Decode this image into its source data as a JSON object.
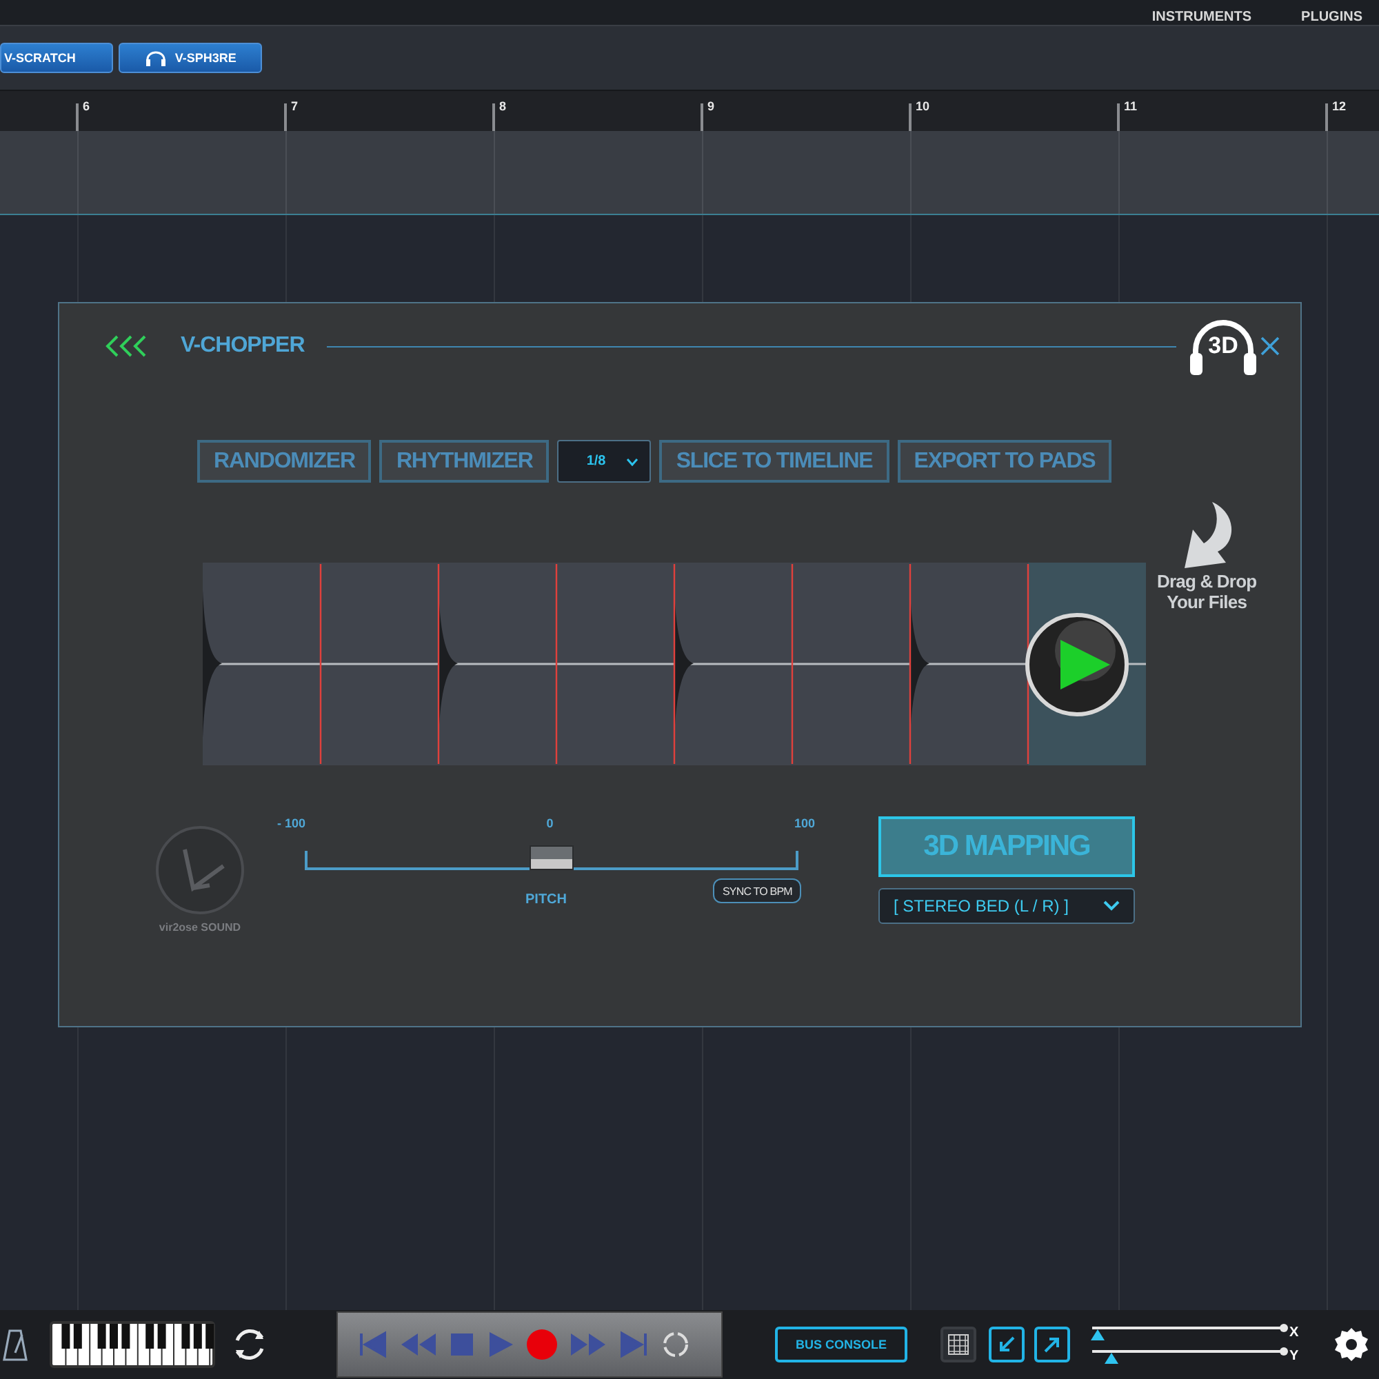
{
  "top_menu": [
    "INSTRUMENTS",
    "PLUGINS"
  ],
  "plugin_tabs": [
    {
      "kind": "plain",
      "label": "V-SCRATCH"
    },
    {
      "kind": "headphones",
      "label": "V-SPH3RE"
    }
  ],
  "ruler": {
    "marks": [
      "6",
      "7",
      "8",
      "9",
      "10",
      "11",
      "12"
    ]
  },
  "chopper": {
    "title": "V-CHOPPER",
    "badge": "3D",
    "toolbar": [
      {
        "kind": "button",
        "label": "RANDOMIZER"
      },
      {
        "kind": "button",
        "label": "RHYTHMIZER"
      },
      {
        "kind": "dropdown",
        "value": "1/8"
      },
      {
        "kind": "button",
        "label": "SLICE TO TIMELINE"
      },
      {
        "kind": "button",
        "label": "EXPORT TO PADS"
      }
    ],
    "slices": [
      {
        "selected": false
      },
      {
        "selected": false
      },
      {
        "selected": false
      },
      {
        "selected": false
      },
      {
        "selected": false
      },
      {
        "selected": false
      },
      {
        "selected": false
      },
      {
        "selected": true
      }
    ],
    "drop_hint": [
      "Drag & Drop",
      "Your Files"
    ],
    "logo_text": "vir2ose SOUND",
    "pitch": {
      "min_label": "- 100",
      "mid_label": "0",
      "max_label": "100",
      "label": "PITCH",
      "level": 0.5
    },
    "sync_button": "SYNC TO BPM",
    "mapping_button": "3D MAPPING",
    "output": {
      "value": "[ STEREO BED (L / R) ]"
    }
  },
  "bus_console": "BUS CONSOLE",
  "xy": [
    {
      "label": "X",
      "level": 0.03
    },
    {
      "label": "Y",
      "level": 0.1
    }
  ]
}
